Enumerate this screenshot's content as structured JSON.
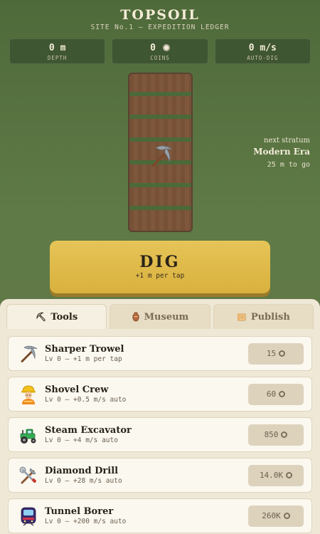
{
  "header": {
    "title": "TOPSOIL",
    "subtitle": "SITE No.1 — EXPEDITION LEDGER"
  },
  "stats": [
    {
      "value": "0 m",
      "label": "DEPTH"
    },
    {
      "value": "0",
      "label": "COINS",
      "icon": "coin-icon"
    },
    {
      "value": "0 m/s",
      "label": "AUTO-DIG"
    }
  ],
  "next_stratum": {
    "label": "next stratum",
    "name": "Modern Era",
    "to_go": "25 m to go"
  },
  "dig": {
    "label": "DIG",
    "sub": "+1 m per tap"
  },
  "tabs": [
    {
      "label": "Tools",
      "icon": "pickaxe-icon",
      "active": true
    },
    {
      "label": "Museum",
      "icon": "vase-icon",
      "active": false
    },
    {
      "label": "Publish",
      "icon": "scroll-icon",
      "active": false
    }
  ],
  "shop": [
    {
      "name": "Sharper Trowel",
      "desc": "Lv 0 — +1 m per tap",
      "price": "15",
      "icon": "pickaxe-icon"
    },
    {
      "name": "Shovel Crew",
      "desc": "Lv 0 — +0.5 m/s auto",
      "price": "60",
      "icon": "construction-worker-icon"
    },
    {
      "name": "Steam Excavator",
      "desc": "Lv 0 — +4 m/s auto",
      "price": "850",
      "icon": "tractor-icon"
    },
    {
      "name": "Diamond Drill",
      "desc": "Lv 0 — +28 m/s auto",
      "price": "14.0K",
      "icon": "tools-icon"
    },
    {
      "name": "Tunnel Borer",
      "desc": "Lv 0 — +200 m/s auto",
      "price": "260K",
      "icon": "train-icon"
    }
  ],
  "colors": {
    "background": "#5f7a46",
    "dig_button": "#e0bb4a",
    "panel": "#f0e8d6",
    "shaft": "#7b5438"
  }
}
